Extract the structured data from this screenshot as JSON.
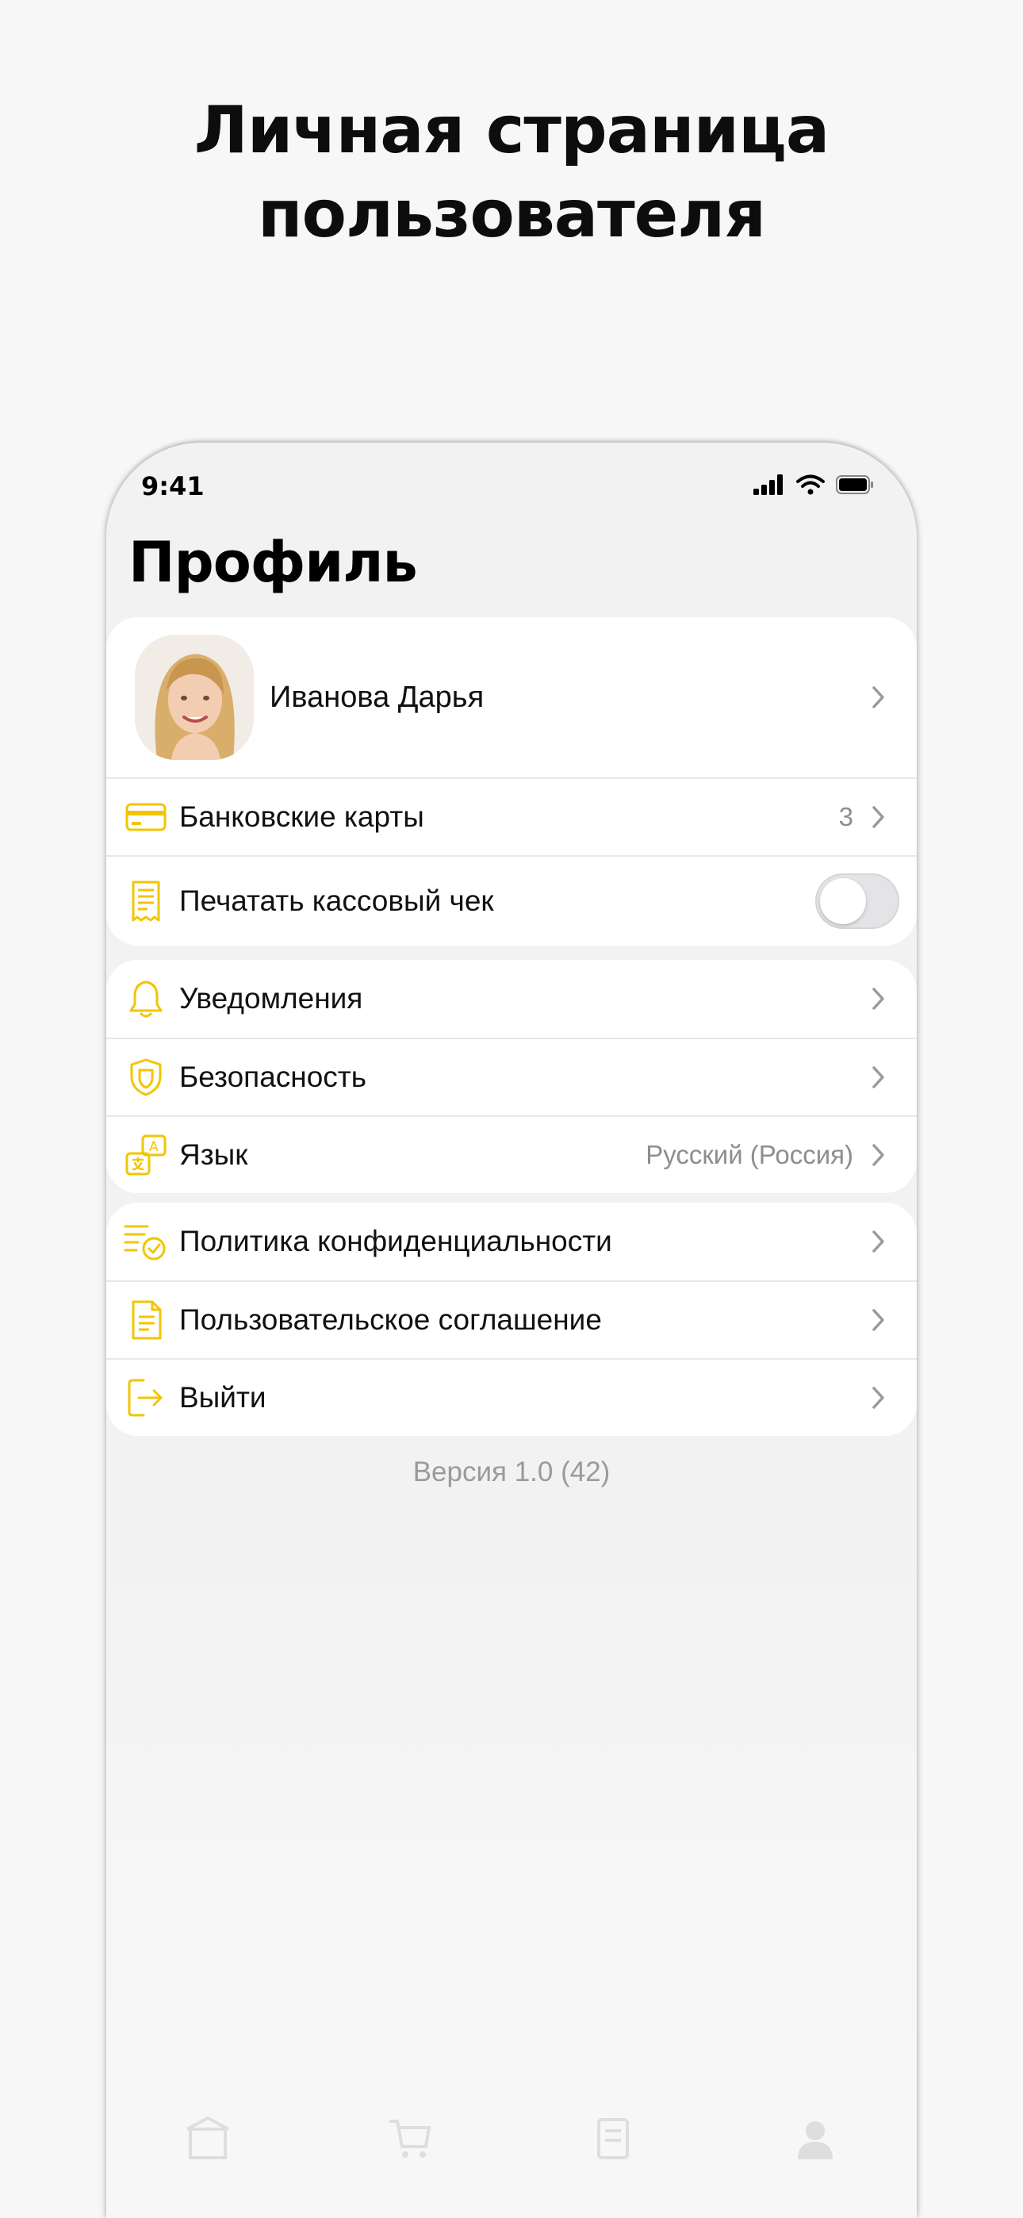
{
  "promo": {
    "title_line1": "Личная страница",
    "title_line2": "пользователя"
  },
  "status_bar": {
    "time": "9:41"
  },
  "page": {
    "title": "Профиль"
  },
  "profile": {
    "name": "Иванова Дарья",
    "avatar_icon": "user-photo"
  },
  "group1": [
    {
      "label": "Банковские карты",
      "value": "3",
      "icon": "credit-card-icon"
    },
    {
      "label": "Печатать кассовый чек",
      "icon": "receipt-icon",
      "toggle_on": false
    }
  ],
  "group2": [
    {
      "label": "Уведомления",
      "icon": "bell-icon"
    },
    {
      "label": "Безопасность",
      "icon": "shield-icon"
    },
    {
      "label": "Язык",
      "value": "Русский (Россия)",
      "icon": "translate-icon"
    }
  ],
  "group3": [
    {
      "label": "Политика конфиденциальности",
      "icon": "privacy-policy-icon"
    },
    {
      "label": "Пользовательское соглашение",
      "icon": "document-icon"
    },
    {
      "label": "Выйти",
      "icon": "logout-icon"
    }
  ],
  "version": "Версия 1.0 (42)",
  "colors": {
    "accent": "#F2C500",
    "background": "#F2F2F2",
    "card": "#FFFFFF",
    "secondary_text": "#8E8E8E"
  }
}
